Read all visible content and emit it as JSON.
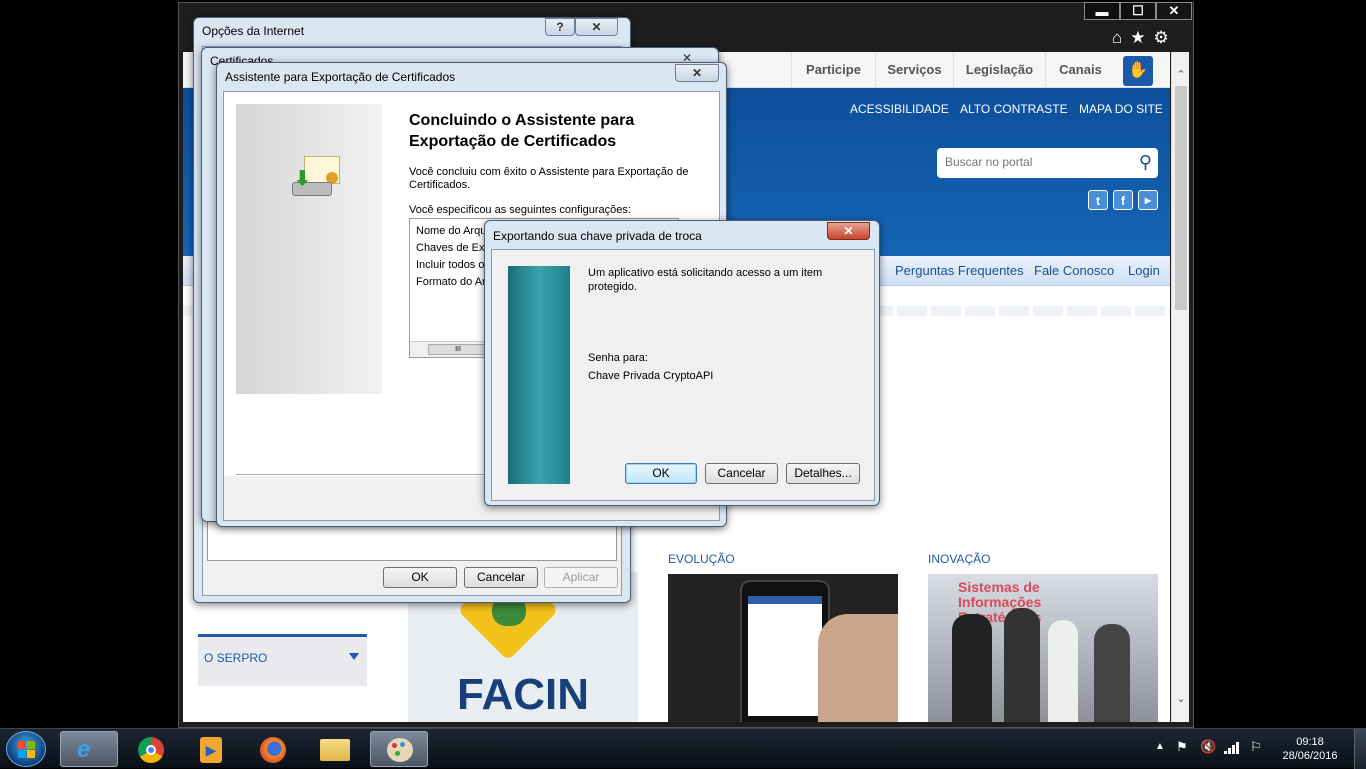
{
  "browser": {
    "minimize": "▬",
    "maximize": "☐",
    "close": "✕",
    "tools": [
      "home-icon",
      "favorites-star-icon",
      "settings-gear-icon"
    ]
  },
  "site": {
    "topnav": [
      "Participe",
      "Serviços",
      "Legislação",
      "Canais"
    ],
    "header_links": [
      "ACESSIBILIDADE",
      "ALTO CONTRASTE",
      "MAPA DO SITE"
    ],
    "search_placeholder": "Buscar no portal",
    "subnav": [
      "Perguntas Frequentes",
      "Fale Conosco",
      "Login"
    ],
    "sections": [
      "EVOLUÇÃO",
      "INOVAÇÃO"
    ],
    "serpro": "O SERPRO",
    "facin": "FACIN",
    "inovacao_img_text": "Sistemas de Informações Estratégicas Fi..."
  },
  "internet_options": {
    "title": "Opções da Internet",
    "help": "?",
    "close": "✕",
    "ok": "OK",
    "cancel": "Cancelar",
    "apply": "Aplicar"
  },
  "certificates": {
    "title": "Certificados",
    "close": "✕"
  },
  "wizard": {
    "title": "Assistente para Exportação de Certificados",
    "close": "✕",
    "heading_line1": "Concluindo o Assistente para",
    "heading_line2": "Exportação de Certificados",
    "success_text": "Você concluiu com êxito o Assistente para Exportação de Certificados.",
    "specified_label": "Você especificou as seguintes configurações:",
    "settings": [
      "Nome do Arqu",
      "Chaves de Exp",
      "Incluir todos o",
      "Formato do Ar"
    ]
  },
  "private_key_dialog": {
    "title": "Exportando sua chave privada de troca",
    "close": "✕",
    "message": "Um aplicativo está solicitando acesso a um item protegido.",
    "password_for": "Senha para:",
    "key_name": "Chave Privada CryptoAPI",
    "ok": "OK",
    "cancel": "Cancelar",
    "details": "Detalhes..."
  },
  "taskbar": {
    "apps": [
      "internet-explorer-icon",
      "chrome-icon",
      "media-player-icon",
      "firefox-icon",
      "file-explorer-icon",
      "paint-icon"
    ],
    "time": "09:18",
    "date": "28/06/2016"
  }
}
